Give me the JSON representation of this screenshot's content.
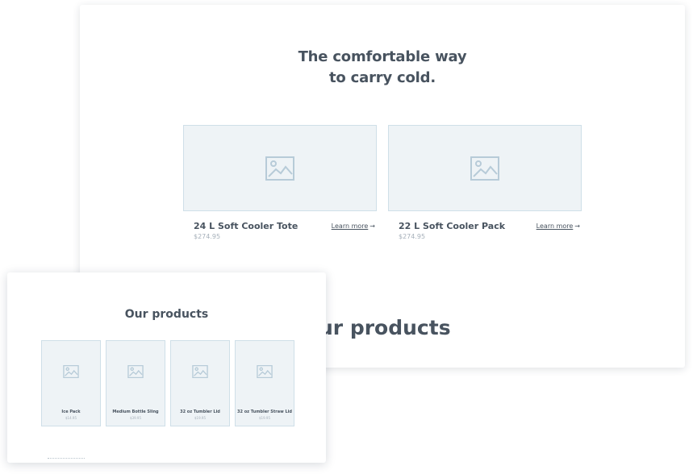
{
  "hero": {
    "title_line1": "The comfortable way",
    "title_line2": "to carry cold."
  },
  "featured_products": [
    {
      "name": "24 L Soft Cooler Tote",
      "price": "$274.95",
      "link": "Learn more"
    },
    {
      "name": "22 L Soft Cooler Pack",
      "price": "$274.95",
      "link": "Learn more"
    }
  ],
  "back_section_heading": "ur products",
  "products_section": {
    "title": "Our products",
    "items": [
      {
        "name": "Ice Pack",
        "price": "$14.95"
      },
      {
        "name": "Medium Bottle Sling",
        "price": "$39.95"
      },
      {
        "name": "32 oz Tumbler Lid",
        "price": "$19.95"
      },
      {
        "name": "32 oz Tumbler Straw Lid",
        "price": "$19.95"
      }
    ]
  },
  "icons": {
    "image_placeholder": "image-placeholder-icon",
    "arrow": "arrow-right-icon"
  },
  "colors": {
    "text": "#48535f",
    "muted": "#a6b0ba",
    "placeholder_bg": "#eef3f6",
    "placeholder_border": "#cfdfe8"
  }
}
